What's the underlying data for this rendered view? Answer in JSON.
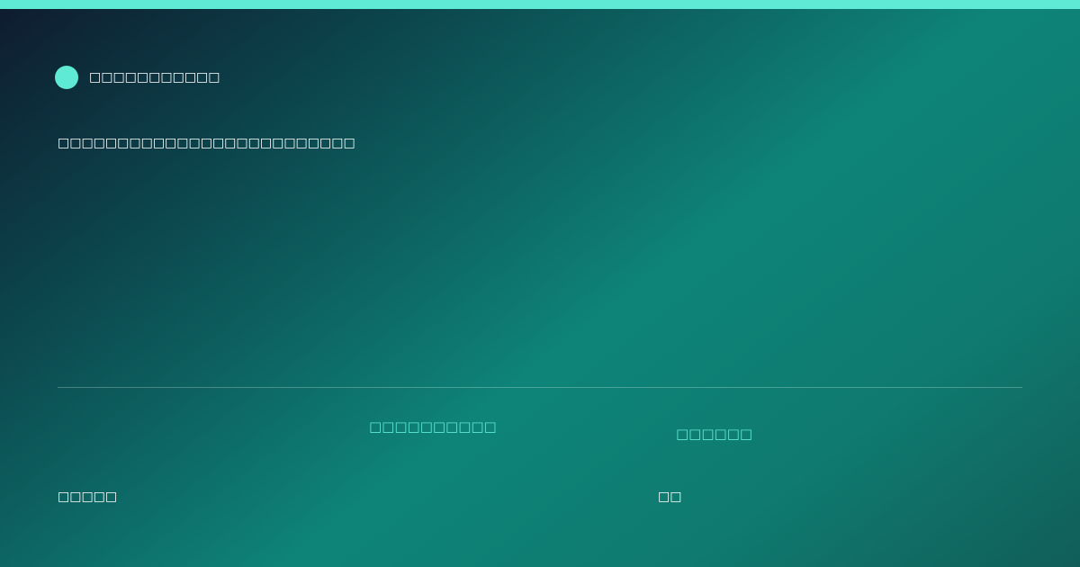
{
  "colors": {
    "accent": "#5eead4",
    "gradient_start": "#0e1b2e",
    "gradient_mid": "#0e8478",
    "gradient_end": "#115e59",
    "text": "#ffffff"
  },
  "brand": {
    "name": "□□□□□□□□□□□",
    "icon": "circle-dot-icon"
  },
  "headline": "□□□□□□□□□□□□□□□□□□□□□□□□□",
  "footer": {
    "left": {
      "label": "□□□□□□□□□□",
      "value": "□□□□□"
    },
    "right": {
      "label": "□□□□□□",
      "value": "□□"
    }
  }
}
